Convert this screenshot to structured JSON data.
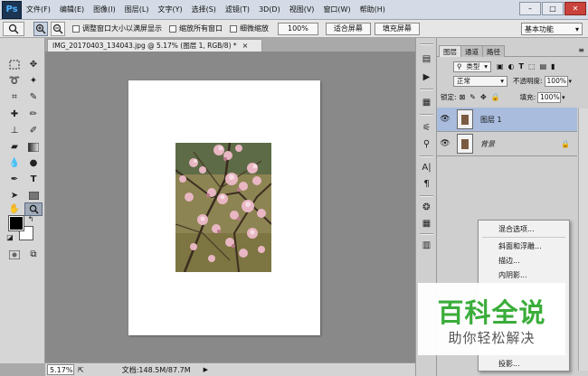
{
  "app": {
    "logo": "Ps"
  },
  "menu": [
    "文件(F)",
    "编辑(E)",
    "图像(I)",
    "图层(L)",
    "文字(Y)",
    "选择(S)",
    "滤镜(T)",
    "3D(D)",
    "视图(V)",
    "窗口(W)",
    "帮助(H)"
  ],
  "window_controls": {
    "minimize": "–",
    "maximize": "□",
    "close": "✕"
  },
  "options_bar": {
    "tool_icon": "zoom-icon",
    "resize_windows_label": "调整窗口大小以满屏显示",
    "zoom_all_label": "缩放所有窗口",
    "scrubby_zoom_label": "细微缩放",
    "actual_pixels_label": "100%",
    "fit_screen_label": "适合屏幕",
    "fill_screen_label": "填充屏幕",
    "workspace": "基本功能"
  },
  "document": {
    "tab_title": "IMG_20170403_134043.jpg @ 5.17% (图层 1, RGB/8) *",
    "close_glyph": "×",
    "zoom": "5.17%",
    "info": "文档:148.5M/87.7M"
  },
  "layers_panel": {
    "tabs": [
      "图层",
      "通道",
      "路径"
    ],
    "filter_kind": "类型",
    "blend_mode": "正常",
    "opacity_label": "不透明度:",
    "opacity": "100%",
    "lock_label": "锁定:",
    "fill_label": "填充:",
    "fill": "100%",
    "layers": [
      {
        "name": "图层 1",
        "selected": true,
        "locked": false
      },
      {
        "name": "背景",
        "selected": false,
        "locked": true
      }
    ]
  },
  "context_menu": {
    "items": [
      "混合选项...",
      "斜面和浮雕...",
      "描边...",
      "内阴影...",
      "投影..."
    ]
  },
  "watermark": {
    "title": "百科全说",
    "subtitle": "助你轻松解决"
  },
  "colors": {
    "foreground": "#000000",
    "background": "#ffffff",
    "selected_layer": "#a9bcdd",
    "watermark_green": "#3aad3a"
  }
}
